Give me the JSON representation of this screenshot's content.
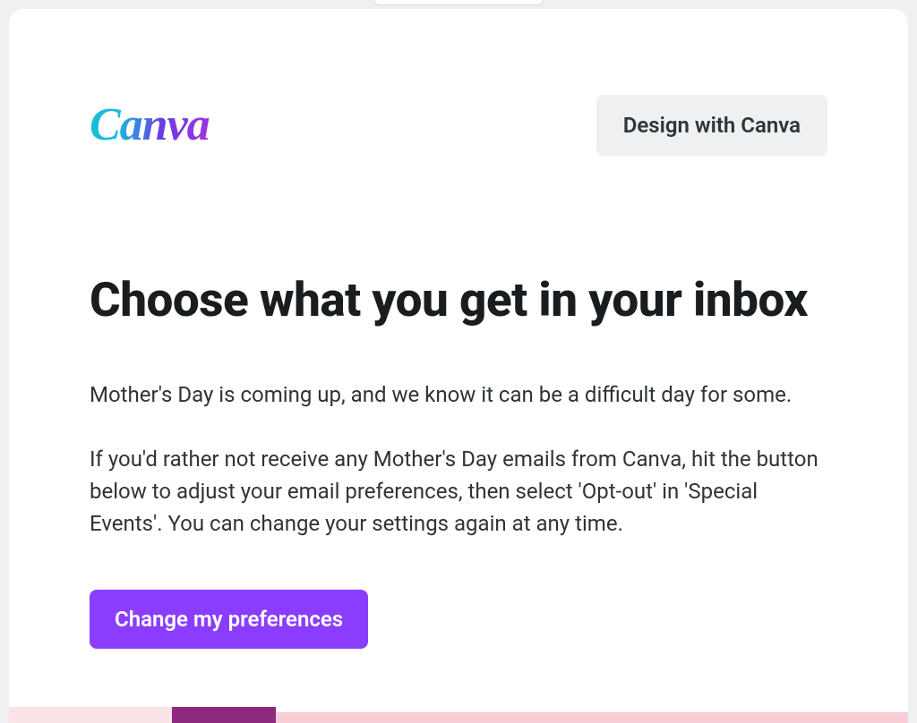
{
  "header": {
    "logo_text": "Canva",
    "design_button_label": "Design with Canva"
  },
  "main": {
    "heading": "Choose what you get in your inbox",
    "paragraph1": "Mother's Day is coming up, and we know it can be a difficult day for some.",
    "paragraph2": "If you'd rather not receive any Mother's Day emails from Canva, hit the button below to adjust your email preferences, then select 'Opt-out' in 'Special Events'. You can change your settings again at any time.",
    "cta_label": "Change my preferences"
  },
  "colors": {
    "accent": "#8b3dff",
    "button_gray": "#eef0f2",
    "pink_light": "#fbe4e8",
    "pink_mid": "#f9cdd5",
    "purple_dark": "#8e2a7d"
  }
}
